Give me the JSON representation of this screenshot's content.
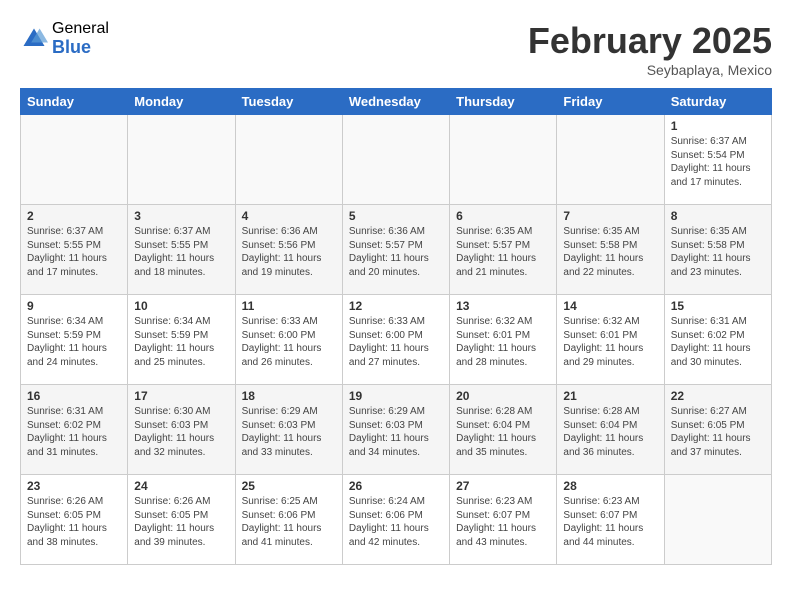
{
  "header": {
    "logo_general": "General",
    "logo_blue": "Blue",
    "month": "February 2025",
    "location": "Seybaplaya, Mexico"
  },
  "weekdays": [
    "Sunday",
    "Monday",
    "Tuesday",
    "Wednesday",
    "Thursday",
    "Friday",
    "Saturday"
  ],
  "weeks": [
    [
      {
        "day": "",
        "content": ""
      },
      {
        "day": "",
        "content": ""
      },
      {
        "day": "",
        "content": ""
      },
      {
        "day": "",
        "content": ""
      },
      {
        "day": "",
        "content": ""
      },
      {
        "day": "",
        "content": ""
      },
      {
        "day": "1",
        "content": "Sunrise: 6:37 AM\nSunset: 5:54 PM\nDaylight: 11 hours and 17 minutes."
      }
    ],
    [
      {
        "day": "2",
        "content": "Sunrise: 6:37 AM\nSunset: 5:55 PM\nDaylight: 11 hours and 17 minutes."
      },
      {
        "day": "3",
        "content": "Sunrise: 6:37 AM\nSunset: 5:55 PM\nDaylight: 11 hours and 18 minutes."
      },
      {
        "day": "4",
        "content": "Sunrise: 6:36 AM\nSunset: 5:56 PM\nDaylight: 11 hours and 19 minutes."
      },
      {
        "day": "5",
        "content": "Sunrise: 6:36 AM\nSunset: 5:57 PM\nDaylight: 11 hours and 20 minutes."
      },
      {
        "day": "6",
        "content": "Sunrise: 6:35 AM\nSunset: 5:57 PM\nDaylight: 11 hours and 21 minutes."
      },
      {
        "day": "7",
        "content": "Sunrise: 6:35 AM\nSunset: 5:58 PM\nDaylight: 11 hours and 22 minutes."
      },
      {
        "day": "8",
        "content": "Sunrise: 6:35 AM\nSunset: 5:58 PM\nDaylight: 11 hours and 23 minutes."
      }
    ],
    [
      {
        "day": "9",
        "content": "Sunrise: 6:34 AM\nSunset: 5:59 PM\nDaylight: 11 hours and 24 minutes."
      },
      {
        "day": "10",
        "content": "Sunrise: 6:34 AM\nSunset: 5:59 PM\nDaylight: 11 hours and 25 minutes."
      },
      {
        "day": "11",
        "content": "Sunrise: 6:33 AM\nSunset: 6:00 PM\nDaylight: 11 hours and 26 minutes."
      },
      {
        "day": "12",
        "content": "Sunrise: 6:33 AM\nSunset: 6:00 PM\nDaylight: 11 hours and 27 minutes."
      },
      {
        "day": "13",
        "content": "Sunrise: 6:32 AM\nSunset: 6:01 PM\nDaylight: 11 hours and 28 minutes."
      },
      {
        "day": "14",
        "content": "Sunrise: 6:32 AM\nSunset: 6:01 PM\nDaylight: 11 hours and 29 minutes."
      },
      {
        "day": "15",
        "content": "Sunrise: 6:31 AM\nSunset: 6:02 PM\nDaylight: 11 hours and 30 minutes."
      }
    ],
    [
      {
        "day": "16",
        "content": "Sunrise: 6:31 AM\nSunset: 6:02 PM\nDaylight: 11 hours and 31 minutes."
      },
      {
        "day": "17",
        "content": "Sunrise: 6:30 AM\nSunset: 6:03 PM\nDaylight: 11 hours and 32 minutes."
      },
      {
        "day": "18",
        "content": "Sunrise: 6:29 AM\nSunset: 6:03 PM\nDaylight: 11 hours and 33 minutes."
      },
      {
        "day": "19",
        "content": "Sunrise: 6:29 AM\nSunset: 6:03 PM\nDaylight: 11 hours and 34 minutes."
      },
      {
        "day": "20",
        "content": "Sunrise: 6:28 AM\nSunset: 6:04 PM\nDaylight: 11 hours and 35 minutes."
      },
      {
        "day": "21",
        "content": "Sunrise: 6:28 AM\nSunset: 6:04 PM\nDaylight: 11 hours and 36 minutes."
      },
      {
        "day": "22",
        "content": "Sunrise: 6:27 AM\nSunset: 6:05 PM\nDaylight: 11 hours and 37 minutes."
      }
    ],
    [
      {
        "day": "23",
        "content": "Sunrise: 6:26 AM\nSunset: 6:05 PM\nDaylight: 11 hours and 38 minutes."
      },
      {
        "day": "24",
        "content": "Sunrise: 6:26 AM\nSunset: 6:05 PM\nDaylight: 11 hours and 39 minutes."
      },
      {
        "day": "25",
        "content": "Sunrise: 6:25 AM\nSunset: 6:06 PM\nDaylight: 11 hours and 41 minutes."
      },
      {
        "day": "26",
        "content": "Sunrise: 6:24 AM\nSunset: 6:06 PM\nDaylight: 11 hours and 42 minutes."
      },
      {
        "day": "27",
        "content": "Sunrise: 6:23 AM\nSunset: 6:07 PM\nDaylight: 11 hours and 43 minutes."
      },
      {
        "day": "28",
        "content": "Sunrise: 6:23 AM\nSunset: 6:07 PM\nDaylight: 11 hours and 44 minutes."
      },
      {
        "day": "",
        "content": ""
      }
    ]
  ]
}
